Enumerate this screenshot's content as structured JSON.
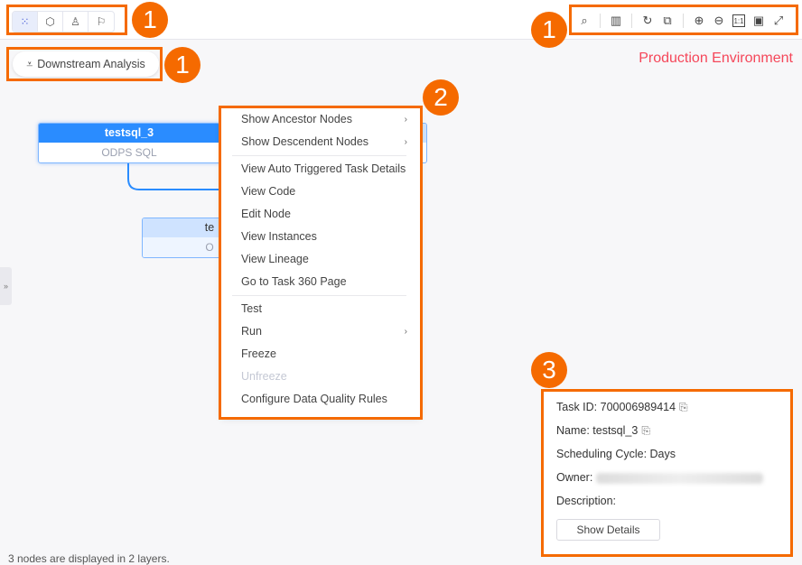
{
  "view_tabs": [
    {
      "icon": "grid-icon",
      "glyph": "⁙",
      "active": true
    },
    {
      "icon": "cube-icon",
      "glyph": "⬡"
    },
    {
      "icon": "user-icon",
      "glyph": "♙"
    },
    {
      "icon": "flag-icon",
      "glyph": "⚐"
    }
  ],
  "toolbar": [
    {
      "icon": "search-icon",
      "glyph": "⌕"
    },
    {
      "sep": true
    },
    {
      "icon": "map-icon",
      "glyph": "▥"
    },
    {
      "sep": true
    },
    {
      "icon": "refresh-icon",
      "glyph": "↻"
    },
    {
      "icon": "overlap-icon",
      "glyph": "⧉"
    },
    {
      "sep": true
    },
    {
      "icon": "zoom-in-icon",
      "glyph": "⊕"
    },
    {
      "icon": "zoom-out-icon",
      "glyph": "⊖"
    },
    {
      "icon": "actual-size-icon",
      "glyph": "1:1"
    },
    {
      "icon": "fit-view-icon",
      "glyph": "▣"
    },
    {
      "icon": "fullscreen-icon",
      "glyph": "⤢"
    }
  ],
  "downstream_label": "Downstream Analysis",
  "environment": "Production Environment",
  "environment_color": "#f5475a",
  "annotation_color": "#f56a00",
  "annotations": [
    "1",
    "1",
    "1",
    "2",
    "3"
  ],
  "nodes": [
    {
      "name": "testsql_3",
      "type": "ODPS SQL"
    },
    {
      "name": "te",
      "type": "O"
    }
  ],
  "menu": {
    "items": [
      {
        "label": "Show Ancestor Nodes",
        "submenu": true
      },
      {
        "label": "Show Descendent Nodes",
        "submenu": true
      },
      {
        "divider": true
      },
      {
        "label": "View Auto Triggered Task Details"
      },
      {
        "label": "View Code"
      },
      {
        "label": "Edit Node"
      },
      {
        "label": "View Instances"
      },
      {
        "label": "View Lineage"
      },
      {
        "label": "Go to Task 360 Page"
      },
      {
        "divider": true
      },
      {
        "label": "Test"
      },
      {
        "label": "Run",
        "submenu": true
      },
      {
        "label": "Freeze"
      },
      {
        "label": "Unfreeze",
        "disabled": true
      },
      {
        "label": "Configure Data Quality Rules"
      }
    ]
  },
  "panel": {
    "task_id": "Task ID: 700006989414",
    "name": "Name: testsql_3",
    "cycle": "Scheduling Cycle: Days",
    "owner_label": "Owner:",
    "description": "Description:",
    "show_details": "Show Details"
  },
  "status": "3 nodes are displayed in 2 layers.",
  "collapse_glyph": "»"
}
